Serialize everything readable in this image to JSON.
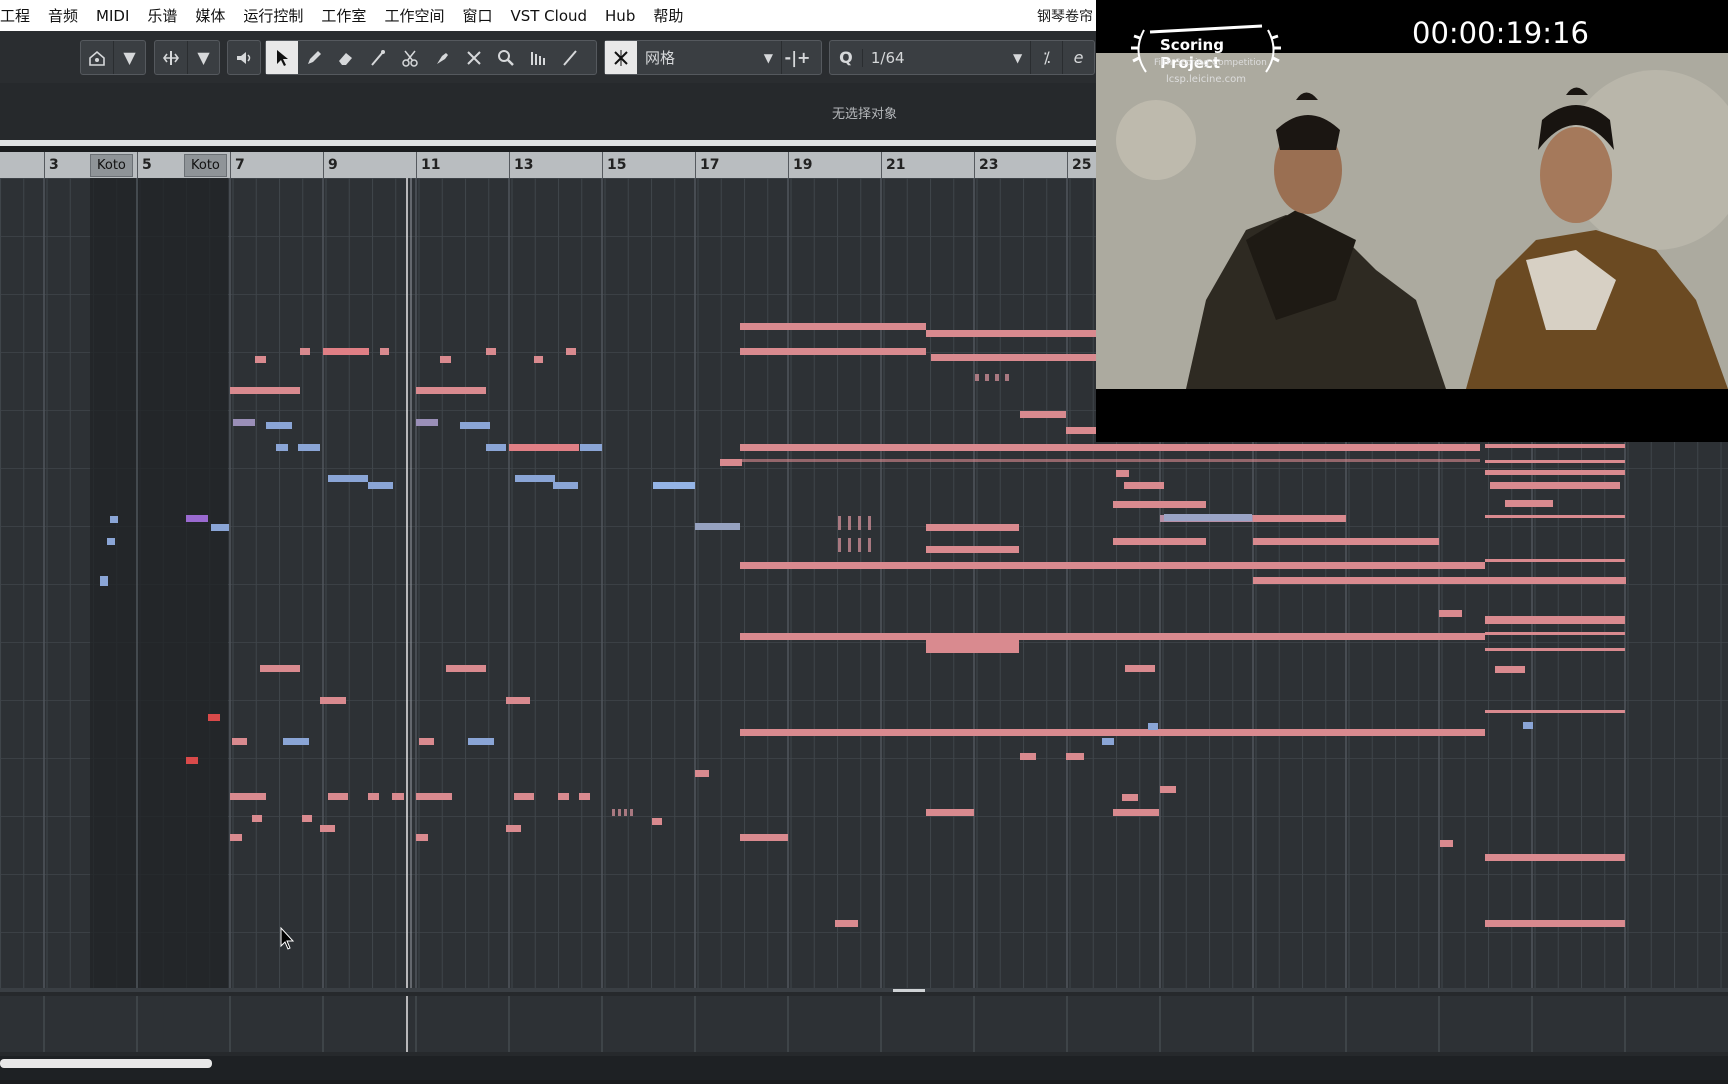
{
  "menu": [
    "工程",
    "音频",
    "MIDI",
    "乐谱",
    "媒体",
    "运行控制",
    "工作室",
    "工作空间",
    "窗口",
    "VST Cloud",
    "Hub",
    "帮助"
  ],
  "window_title": "钢琴卷帘",
  "toolbar": {
    "grid_type": "网格",
    "quantize_label": "Q",
    "quantize_value": "1/64"
  },
  "info_line": "无选择对象",
  "ruler": {
    "bars": [
      "3",
      "5",
      "7",
      "9",
      "11",
      "13",
      "15",
      "17",
      "19",
      "21",
      "23",
      "25"
    ],
    "markers": [
      "Koto",
      "Koto"
    ]
  },
  "video": {
    "timecode": "00:00:19:16",
    "logo_title": "Scoring Project",
    "logo_subtitle": "Film Scoring Competition",
    "logo_url": "lcsp.leicine.com"
  },
  "colors": {
    "note_pink": "#d98a8f",
    "note_blue": "#8aa5d6",
    "note_red": "#d94a4a",
    "note_purple": "#9a6ad0"
  }
}
